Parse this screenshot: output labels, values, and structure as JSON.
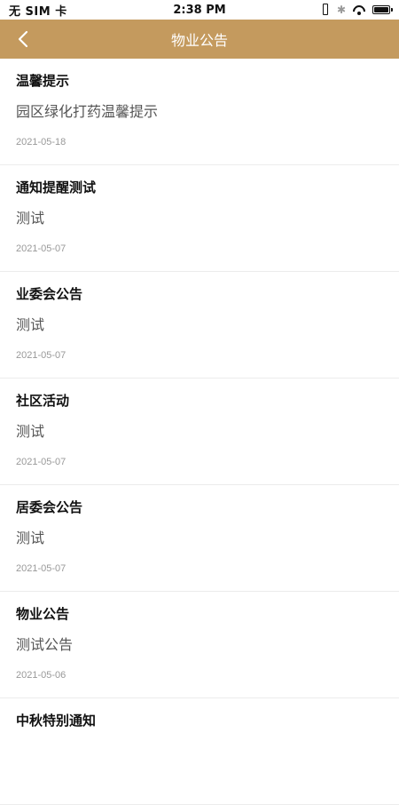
{
  "status_bar": {
    "carrier": "无 SIM 卡",
    "time": "2:38 PM",
    "icons": [
      "vibrate-icon",
      "bluetooth-icon",
      "wifi-icon",
      "battery-icon"
    ]
  },
  "header": {
    "title": "物业公告",
    "back_icon": "chevron-left-icon",
    "background": "#c49a5e"
  },
  "notices": [
    {
      "title": "温馨提示",
      "summary": "园区绿化打药温馨提示",
      "date": "2021-05-18"
    },
    {
      "title": "通知提醒测试",
      "summary": "测试",
      "date": "2021-05-07"
    },
    {
      "title": "业委会公告",
      "summary": "测试",
      "date": "2021-05-07"
    },
    {
      "title": "社区活动",
      "summary": "测试",
      "date": "2021-05-07"
    },
    {
      "title": "居委会公告",
      "summary": "测试",
      "date": "2021-05-07"
    },
    {
      "title": "物业公告",
      "summary": "测试公告",
      "date": "2021-05-06"
    },
    {
      "title": "中秋特别通知",
      "summary": "",
      "date": ""
    }
  ]
}
